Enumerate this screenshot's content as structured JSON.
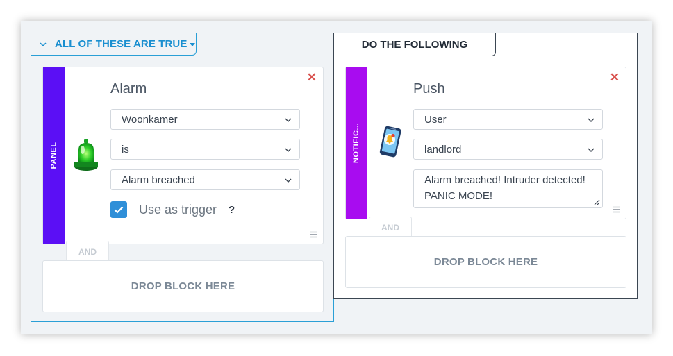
{
  "condition_group": {
    "header_label": "ALL OF THESE ARE TRUE",
    "block": {
      "side_label": "PANEL",
      "side_color": "#5b0ff5",
      "icon": "siren-light-icon",
      "title": "Alarm",
      "selects": [
        "Woonkamer",
        "is",
        "Alarm breached"
      ],
      "use_as_trigger_checked": true,
      "use_as_trigger_label": "Use as trigger",
      "help_label": "?"
    },
    "and_label": "AND",
    "drop_label": "DROP BLOCK HERE"
  },
  "action_group": {
    "header_label": "DO THE FOLLOWING",
    "block": {
      "side_label": "NOTIFIC...",
      "side_color": "#a80cf0",
      "icon": "phone-notification-icon",
      "title": "Push",
      "selects": [
        "User",
        "landlord"
      ],
      "message": "Alarm breached! Intruder detected! PANIC MODE!"
    },
    "and_label": "AND",
    "drop_label": "DROP BLOCK HERE"
  },
  "colors": {
    "accent": "#2a9fd6",
    "close": "#d9534f",
    "checkbox": "#2f8fd8"
  }
}
